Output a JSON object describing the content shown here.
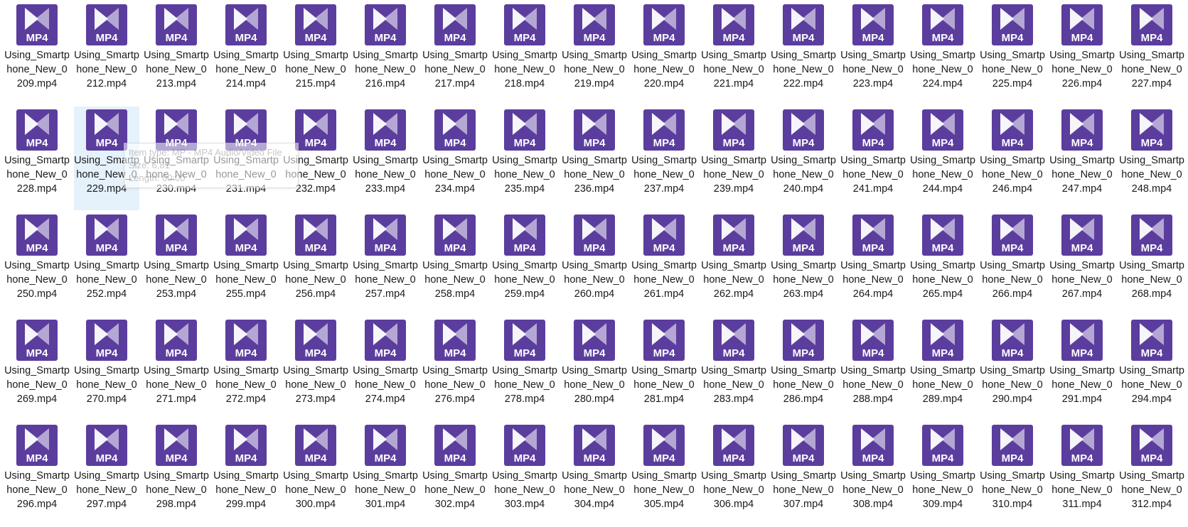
{
  "icon": {
    "name": "mp4-file-icon",
    "label": "MP4",
    "bg_color": "#5b3d9e",
    "play_color": "#ffffff"
  },
  "hovered_index": 18,
  "files": [
    "Using_Smartphone_New_0209.mp4",
    "Using_Smartphone_New_0212.mp4",
    "Using_Smartphone_New_0213.mp4",
    "Using_Smartphone_New_0214.mp4",
    "Using_Smartphone_New_0215.mp4",
    "Using_Smartphone_New_0216.mp4",
    "Using_Smartphone_New_0217.mp4",
    "Using_Smartphone_New_0218.mp4",
    "Using_Smartphone_New_0219.mp4",
    "Using_Smartphone_New_0220.mp4",
    "Using_Smartphone_New_0221.mp4",
    "Using_Smartphone_New_0222.mp4",
    "Using_Smartphone_New_0223.mp4",
    "Using_Smartphone_New_0224.mp4",
    "Using_Smartphone_New_0225.mp4",
    "Using_Smartphone_New_0226.mp4",
    "Using_Smartphone_New_0227.mp4",
    "Using_Smartphone_New_0228.mp4",
    "Using_Smartphone_New_0229.mp4",
    "Using_Smartphone_New_0230.mp4",
    "Using_Smartphone_New_0231.mp4",
    "Using_Smartphone_New_0232.mp4",
    "Using_Smartphone_New_0233.mp4",
    "Using_Smartphone_New_0234.mp4",
    "Using_Smartphone_New_0235.mp4",
    "Using_Smartphone_New_0236.mp4",
    "Using_Smartphone_New_0237.mp4",
    "Using_Smartphone_New_0239.mp4",
    "Using_Smartphone_New_0240.mp4",
    "Using_Smartphone_New_0241.mp4",
    "Using_Smartphone_New_0244.mp4",
    "Using_Smartphone_New_0246.mp4",
    "Using_Smartphone_New_0247.mp4",
    "Using_Smartphone_New_0248.mp4",
    "Using_Smartphone_New_0250.mp4",
    "Using_Smartphone_New_0252.mp4",
    "Using_Smartphone_New_0253.mp4",
    "Using_Smartphone_New_0255.mp4",
    "Using_Smartphone_New_0256.mp4",
    "Using_Smartphone_New_0257.mp4",
    "Using_Smartphone_New_0258.mp4",
    "Using_Smartphone_New_0259.mp4",
    "Using_Smartphone_New_0260.mp4",
    "Using_Smartphone_New_0261.mp4",
    "Using_Smartphone_New_0262.mp4",
    "Using_Smartphone_New_0263.mp4",
    "Using_Smartphone_New_0264.mp4",
    "Using_Smartphone_New_0265.mp4",
    "Using_Smartphone_New_0266.mp4",
    "Using_Smartphone_New_0267.mp4",
    "Using_Smartphone_New_0268.mp4",
    "Using_Smartphone_New_0269.mp4",
    "Using_Smartphone_New_0270.mp4",
    "Using_Smartphone_New_0271.mp4",
    "Using_Smartphone_New_0272.mp4",
    "Using_Smartphone_New_0273.mp4",
    "Using_Smartphone_New_0274.mp4",
    "Using_Smartphone_New_0276.mp4",
    "Using_Smartphone_New_0278.mp4",
    "Using_Smartphone_New_0280.mp4",
    "Using_Smartphone_New_0281.mp4",
    "Using_Smartphone_New_0283.mp4",
    "Using_Smartphone_New_0286.mp4",
    "Using_Smartphone_New_0288.mp4",
    "Using_Smartphone_New_0289.mp4",
    "Using_Smartphone_New_0290.mp4",
    "Using_Smartphone_New_0291.mp4",
    "Using_Smartphone_New_0294.mp4",
    "Using_Smartphone_New_0296.mp4",
    "Using_Smartphone_New_0297.mp4",
    "Using_Smartphone_New_0298.mp4",
    "Using_Smartphone_New_0299.mp4",
    "Using_Smartphone_New_0300.mp4",
    "Using_Smartphone_New_0301.mp4",
    "Using_Smartphone_New_0302.mp4",
    "Using_Smartphone_New_0303.mp4",
    "Using_Smartphone_New_0304.mp4",
    "Using_Smartphone_New_0305.mp4",
    "Using_Smartphone_New_0306.mp4",
    "Using_Smartphone_New_0307.mp4",
    "Using_Smartphone_New_0308.mp4",
    "Using_Smartphone_New_0309.mp4",
    "Using_Smartphone_New_0310.mp4",
    "Using_Smartphone_New_0311.mp4",
    "Using_Smartphone_New_0312.mp4"
  ],
  "tooltip": {
    "type_line": "Item type: MP - MP4 Audio/Video File",
    "size_line": "Size: 6,81",
    "length_line": "Length: 00:00"
  }
}
